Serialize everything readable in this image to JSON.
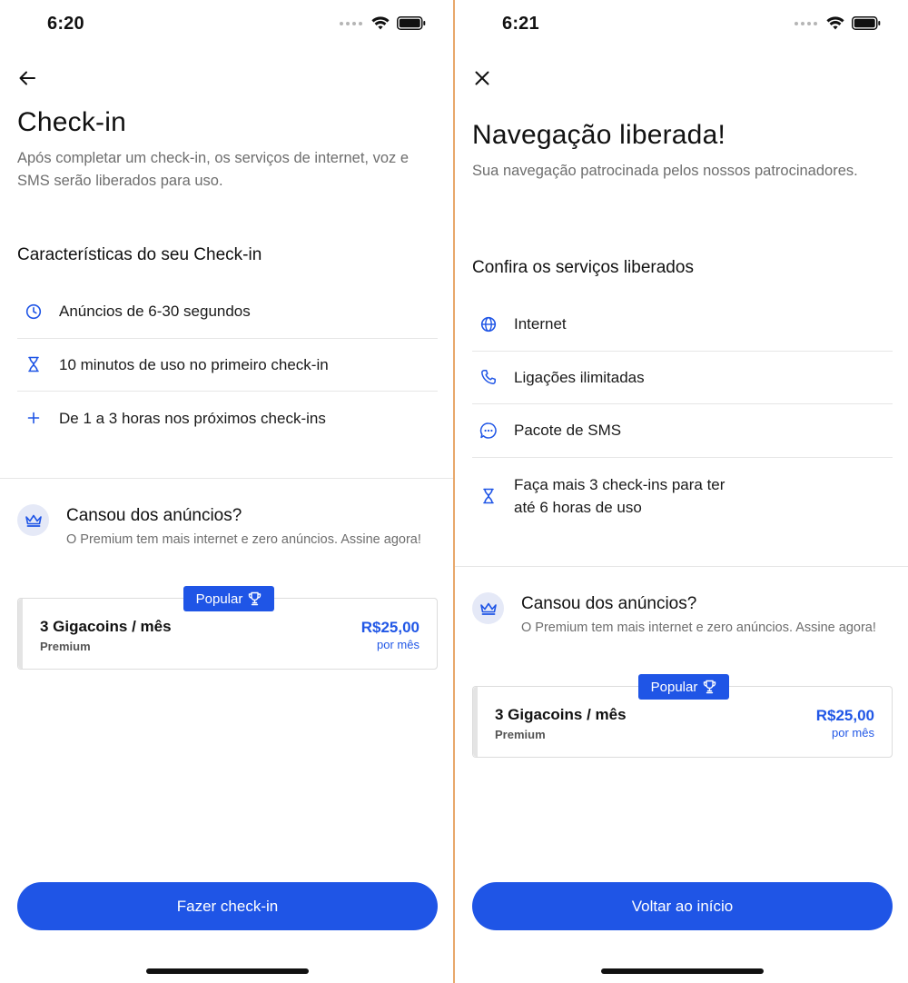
{
  "colors": {
    "accent": "#1f55e6",
    "text_secondary": "#6e6e6e",
    "divider": "#e6e6e6",
    "screen_separator": "#e8a86a",
    "icon_bg": "#e5e9f7"
  },
  "left": {
    "status": {
      "time": "6:20"
    },
    "nav_icon": "back-arrow-icon",
    "title": "Check-in",
    "subtitle": "Após completar um check-in, os serviços de internet, voz e SMS serão liberados para uso.",
    "section_title": "Características do seu Check-in",
    "features": [
      {
        "icon": "clock-icon",
        "text": "Anúncios de 6-30 segundos"
      },
      {
        "icon": "hourglass-icon",
        "text": "10 minutos de uso no primeiro check-in"
      },
      {
        "icon": "plus-icon",
        "text": "De 1 a 3 horas nos próximos check-ins"
      }
    ],
    "promo": {
      "icon": "crown-icon",
      "title": "Cansou dos anúncios?",
      "description": "O Premium tem mais internet e zero anúncios. Assine agora!"
    },
    "plan": {
      "badge": "Popular",
      "badge_icon": "trophy-icon",
      "name": "3 Gigacoins / mês",
      "tier": "Premium",
      "price": "R$25,00",
      "period": "por mês"
    },
    "cta": "Fazer check-in"
  },
  "right": {
    "status": {
      "time": "6:21"
    },
    "nav_icon": "close-icon",
    "title": "Navegação liberada!",
    "subtitle": "Sua navegação patrocinada pelos nossos patrocinadores.",
    "section_title": "Confira os serviços liberados",
    "features": [
      {
        "icon": "globe-icon",
        "text": "Internet"
      },
      {
        "icon": "phone-icon",
        "text": "Ligações ilimitadas"
      },
      {
        "icon": "chat-bubble-icon",
        "text": "Pacote de SMS"
      },
      {
        "icon": "hourglass-icon",
        "text": "Faça mais 3 check-ins para ter\naté 6 horas de uso"
      }
    ],
    "promo": {
      "icon": "crown-icon",
      "title": "Cansou dos anúncios?",
      "description": "O Premium tem mais internet e zero anúncios. Assine agora!"
    },
    "plan": {
      "badge": "Popular",
      "badge_icon": "trophy-icon",
      "name": "3 Gigacoins / mês",
      "tier": "Premium",
      "price": "R$25,00",
      "period": "por mês"
    },
    "cta": "Voltar ao início"
  }
}
